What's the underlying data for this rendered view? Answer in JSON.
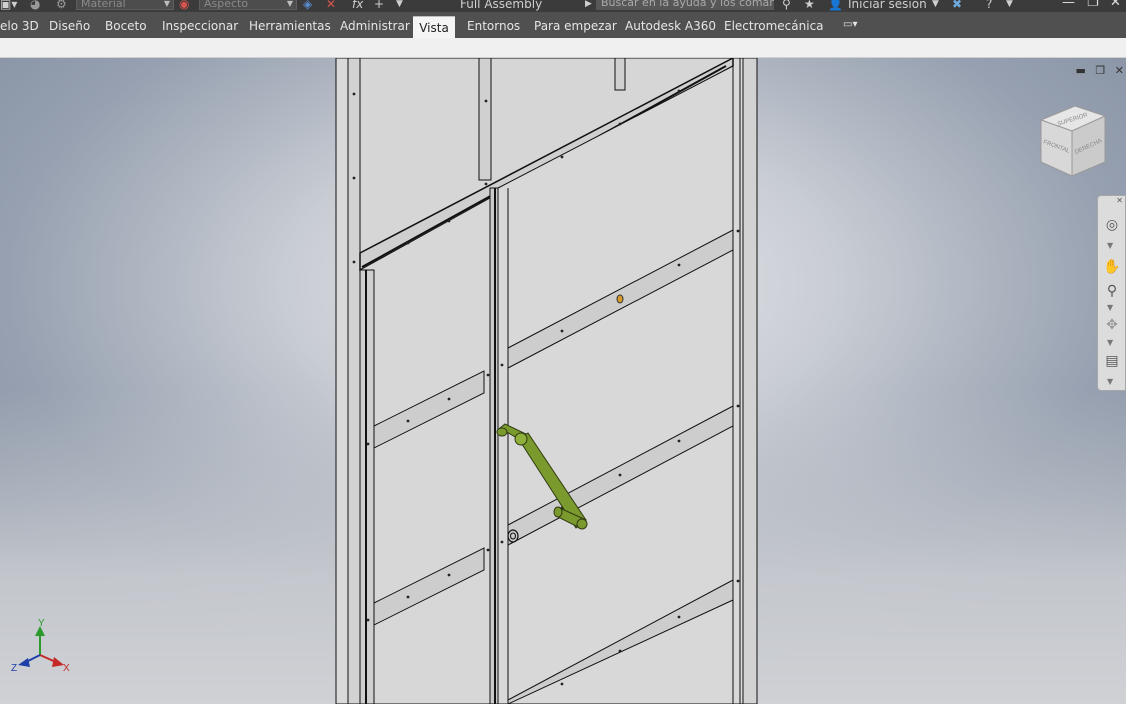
{
  "titlebar": {
    "material_placeholder": "Material",
    "appearance_placeholder": "Aspecto",
    "fx_label": "fx",
    "document_title": "Full Assembly",
    "search_placeholder": "Buscar en la ayuda y los comandos",
    "signin_label": "Iniciar sesión",
    "help_label": "?"
  },
  "ribbon": {
    "tabs": [
      {
        "label": "elo 3D"
      },
      {
        "label": "Diseño"
      },
      {
        "label": "Boceto"
      },
      {
        "label": "Inspeccionar"
      },
      {
        "label": "Herramientas"
      },
      {
        "label": "Administrar"
      },
      {
        "label": "Vista"
      },
      {
        "label": "Entornos"
      },
      {
        "label": "Para empezar"
      },
      {
        "label": "Autodesk A360"
      },
      {
        "label": "Electromecánica"
      }
    ],
    "active_tab": "Vista"
  },
  "viewcube": {
    "top_label": "SUPERIOR",
    "front_label": "FRONTAL",
    "right_label": "DERECHA"
  },
  "triad": {
    "x": "X",
    "y": "Y",
    "z": "Z"
  },
  "colors": {
    "handle": "#7a9a2e",
    "panel": "#d7d7d7",
    "tab_bar": "#505050",
    "title_bar": "#3b3b3b"
  }
}
